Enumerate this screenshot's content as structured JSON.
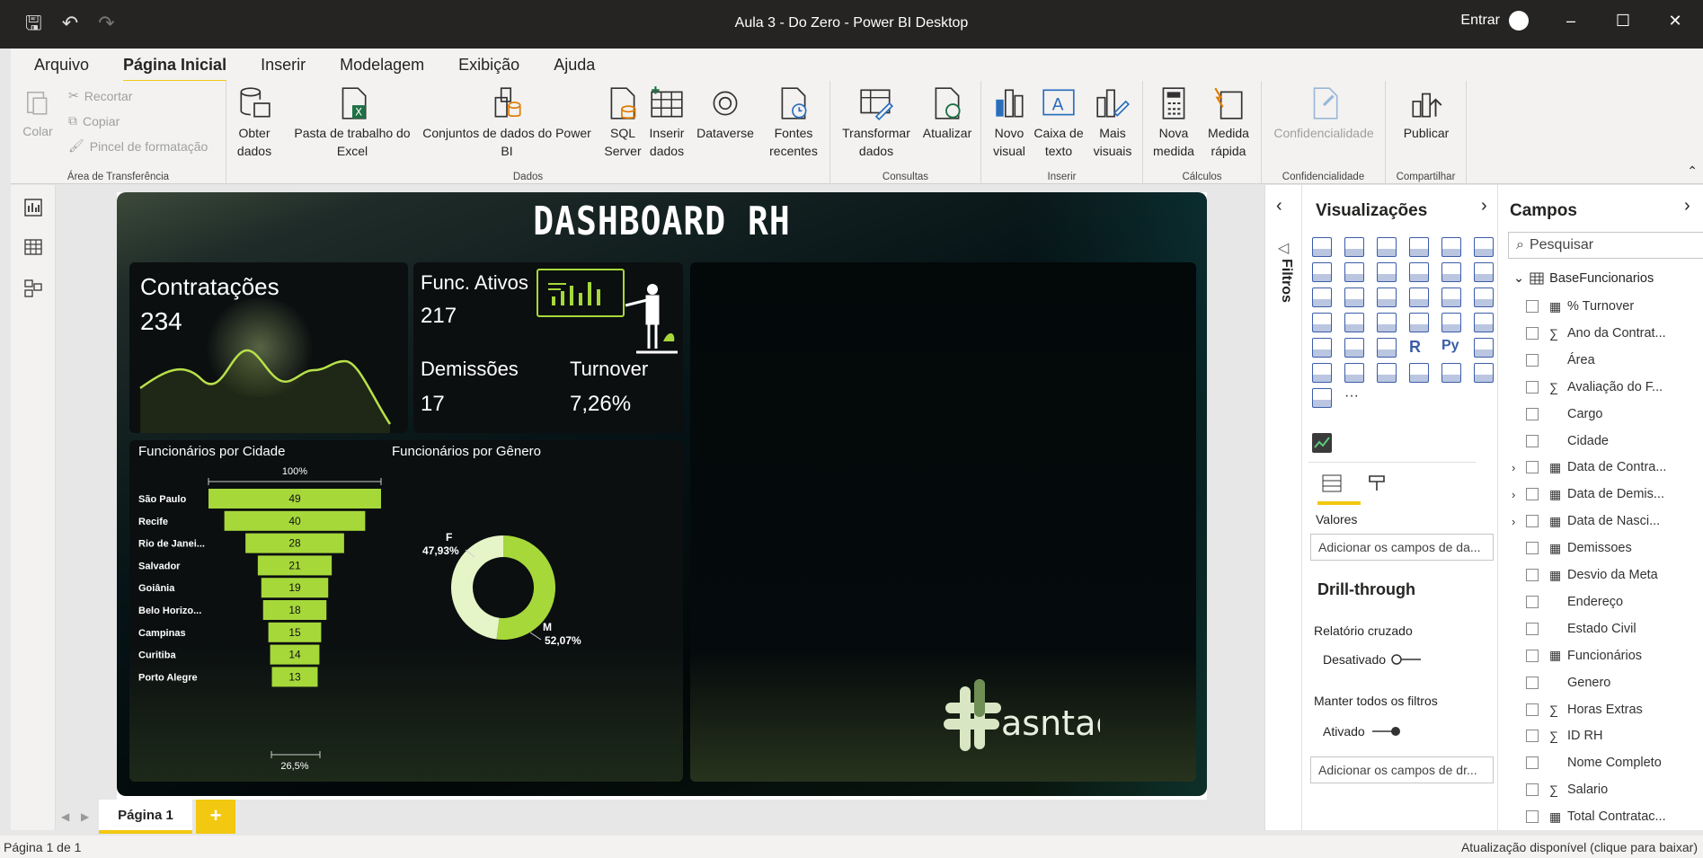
{
  "window": {
    "title": "Aula 3 - Do Zero - Power BI Desktop",
    "signin": "Entrar"
  },
  "menu": [
    "Arquivo",
    "Página Inicial",
    "Inserir",
    "Modelagem",
    "Exibição",
    "Ajuda"
  ],
  "ribbon": {
    "clipboard": {
      "colar": "Colar",
      "recortar": "Recortar",
      "copiar": "Copiar",
      "pincel": "Pincel de formatação",
      "group": "Área de Transferência"
    },
    "dados": {
      "obter": "Obter",
      "obter2": "dados",
      "excel": "Pasta de trabalho do",
      "excel2": "Excel",
      "conjuntos": "Conjuntos de dados do Power",
      "conjuntos2": "BI",
      "sql": "SQL",
      "sql2": "Server",
      "inserir": "Inserir",
      "inserir2": "dados",
      "dataverse": "Dataverse",
      "fontes": "Fontes",
      "fontes2": "recentes",
      "group": "Dados"
    },
    "consultas": {
      "transformar": "Transformar",
      "transformar2": "dados",
      "atualizar": "Atualizar",
      "group": "Consultas"
    },
    "inserir": {
      "novo": "Novo",
      "novo2": "visual",
      "caixa": "Caixa de",
      "caixa2": "texto",
      "mais": "Mais",
      "mais2": "visuais",
      "group": "Inserir"
    },
    "calculos": {
      "nova": "Nova",
      "nova2": "medida",
      "medida": "Medida",
      "medida2": "rápida",
      "group": "Cálculos"
    },
    "conf": {
      "label": "Confidencialidade",
      "group": "Confidencialidade"
    },
    "compartilhar": {
      "publicar": "Publicar",
      "group": "Compartilhar"
    }
  },
  "report": {
    "title": "DASHBOARD RH",
    "contratacoes": {
      "label": "Contratações",
      "value": "234"
    },
    "ativos": {
      "label": "Func. Ativos",
      "value": "217"
    },
    "demissoes": {
      "label": "Demissões",
      "value": "17"
    },
    "turnover": {
      "label": "Turnover",
      "value": "7,26%"
    },
    "brand": "asntag",
    "chart_data": [
      {
        "type": "bar",
        "title": "Funcionários por Cidade",
        "top_label": "100%",
        "bottom_label": "26,5%",
        "categories": [
          "São Paulo",
          "Recife",
          "Rio de Janei...",
          "Salvador",
          "Goiânia",
          "Belo Horizo...",
          "Campinas",
          "Curitiba",
          "Porto Alegre"
        ],
        "values": [
          49,
          40,
          28,
          21,
          19,
          18,
          15,
          14,
          13
        ],
        "color": "#a6d83a"
      },
      {
        "type": "pie",
        "title": "Funcionários por Gênero",
        "categories": [
          "F",
          "M"
        ],
        "labels": [
          "47,93%",
          "52,07%"
        ],
        "values": [
          47.93,
          52.07
        ],
        "colors": [
          "#e6f5c8",
          "#a6d83a"
        ]
      }
    ]
  },
  "viz": {
    "title": "Visualizações",
    "valores": "Valores",
    "add_fields": "Adicionar os campos de da...",
    "drill": "Drill-through",
    "cruzado": "Relatório cruzado",
    "desativado": "Desativado",
    "manter": "Manter todos os filtros",
    "ativado": "Ativado",
    "add_drill": "Adicionar os campos de dr..."
  },
  "filtros": "Filtros",
  "campos": {
    "title": "Campos",
    "search": "Pesquisar",
    "table": "BaseFuncionarios",
    "fields": [
      "% Turnover",
      "Ano da Contrat...",
      "Área",
      "Avaliação do F...",
      "Cargo",
      "Cidade",
      "Data de Contra...",
      "Data de Demis...",
      "Data de Nasci...",
      "Demissoes",
      "Desvio da Meta",
      "Endereço",
      "Estado Civil",
      "Funcionários",
      "Genero",
      "Horas Extras",
      "ID RH",
      "Nome Completo",
      "Salario",
      "Total Contratac..."
    ]
  },
  "pages": {
    "tab": "Página 1"
  },
  "status": {
    "left": "Página 1 de 1",
    "right": "Atualização disponível (clique para baixar)"
  }
}
